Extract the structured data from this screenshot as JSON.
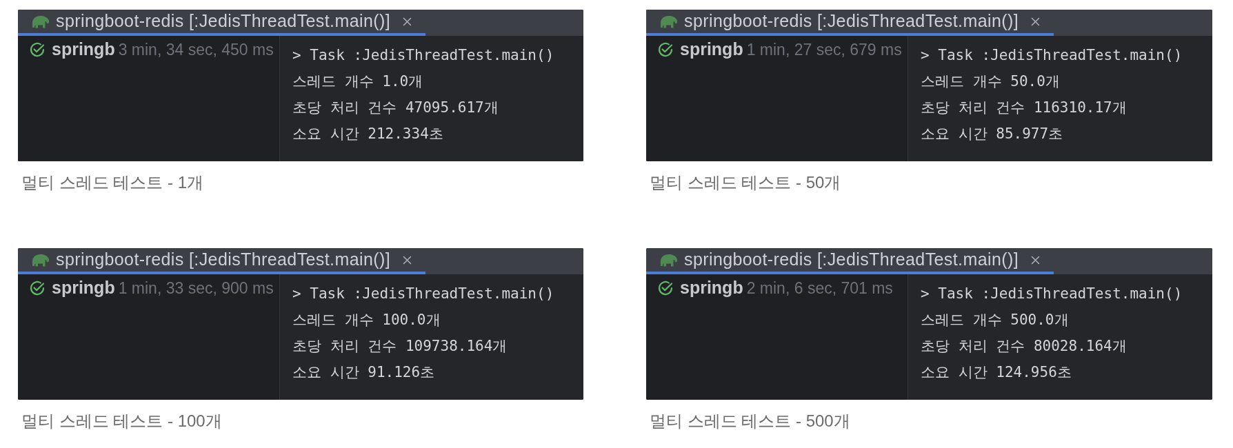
{
  "panels": [
    {
      "tab": {
        "title": "springboot-redis [:JedisThreadTest.main()]",
        "selected": true
      },
      "run": {
        "passed": true,
        "name": "springb",
        "duration": "3 min, 34 sec, 450 ms"
      },
      "console": [
        "> Task :JedisThreadTest.main()",
        "스레드 개수 1.0개",
        "초당 처리 건수 47095.617개",
        "소요 시간 212.334초"
      ],
      "caption": "멀티 스레드 테스트 - 1개"
    },
    {
      "tab": {
        "title": "springboot-redis [:JedisThreadTest.main()]",
        "selected": true
      },
      "run": {
        "passed": true,
        "name": "springb",
        "duration": "1 min, 27 sec, 679 ms"
      },
      "console": [
        "> Task :JedisThreadTest.main()",
        "스레드 개수 50.0개",
        "초당 처리 건수 116310.17개",
        "소요 시간 85.977초"
      ],
      "caption": "멀티 스레드 테스트 - 50개"
    },
    {
      "tab": {
        "title": "springboot-redis [:JedisThreadTest.main()]",
        "selected": true
      },
      "run": {
        "passed": true,
        "name": "springb",
        "duration": "1 min, 33 sec, 900 ms"
      },
      "console": [
        "> Task :JedisThreadTest.main()",
        "스레드 개수 100.0개",
        "초당 처리 건수 109738.164개",
        "소요 시간 91.126초"
      ],
      "caption": "멀티 스레드 테스트 - 100개"
    },
    {
      "tab": {
        "title": "springboot-redis [:JedisThreadTest.main()]",
        "selected": true
      },
      "run": {
        "passed": true,
        "name": "springb",
        "duration": "2 min, 6 sec, 701 ms"
      },
      "console": [
        "> Task :JedisThreadTest.main()",
        "스레드 개수 500.0개",
        "초당 처리 건수 80028.164개",
        "소요 시간 124.956초"
      ],
      "caption": "멀티 스레드 테스트 - 500개"
    }
  ]
}
